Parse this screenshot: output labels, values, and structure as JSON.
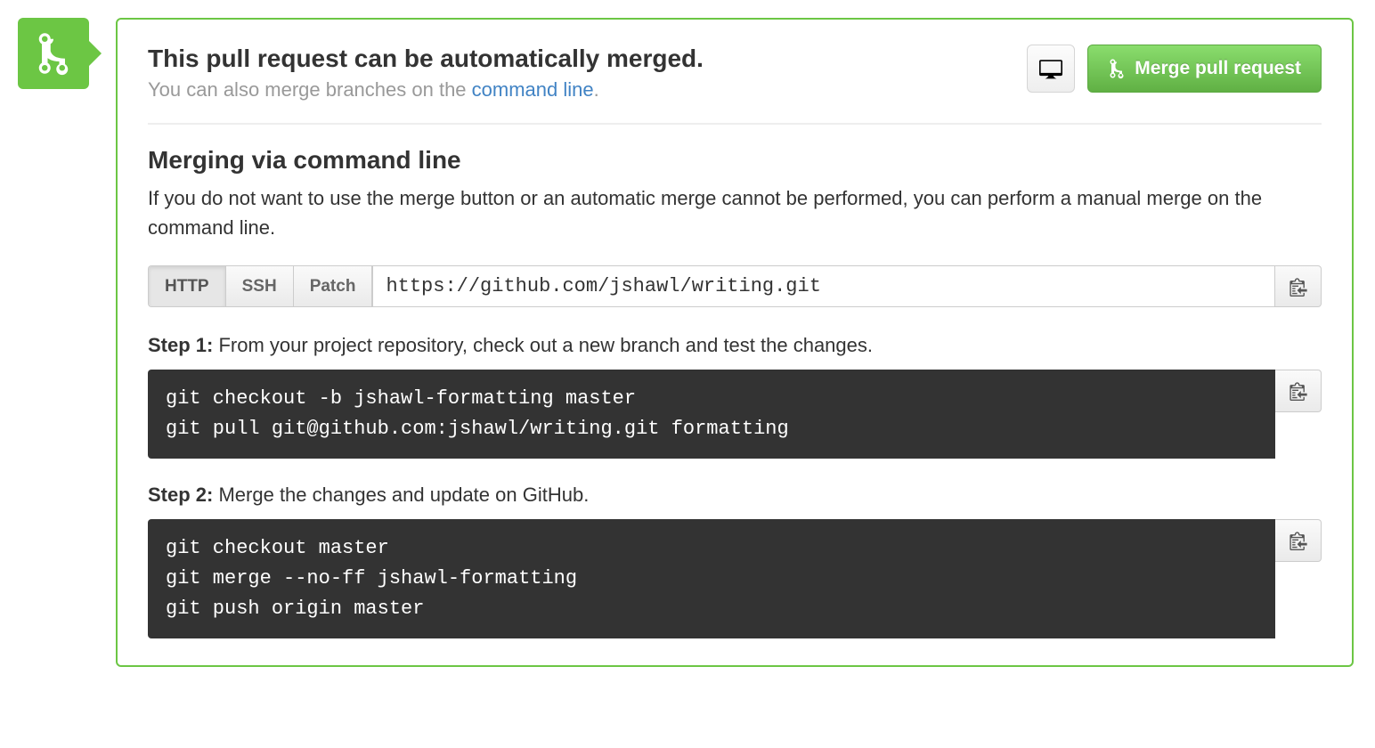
{
  "header": {
    "title": "This pull request can be automatically merged.",
    "subtitle_prefix": "You can also merge branches on the ",
    "subtitle_link": "command line",
    "subtitle_suffix": ".",
    "merge_button": "Merge pull request"
  },
  "section": {
    "title": "Merging via command line",
    "description": "If you do not want to use the merge button or an automatic merge cannot be performed, you can perform a manual merge on the command line."
  },
  "clone": {
    "tabs": {
      "http": "HTTP",
      "ssh": "SSH",
      "patch": "Patch"
    },
    "url": "https://github.com/jshawl/writing.git"
  },
  "steps": [
    {
      "label": "Step 1:",
      "text": " From your project repository, check out a new branch and test the changes.",
      "code": "git checkout -b jshawl-formatting master\ngit pull git@github.com:jshawl/writing.git formatting"
    },
    {
      "label": "Step 2:",
      "text": " Merge the changes and update on GitHub.",
      "code": "git checkout master\ngit merge --no-ff jshawl-formatting\ngit push origin master"
    }
  ]
}
